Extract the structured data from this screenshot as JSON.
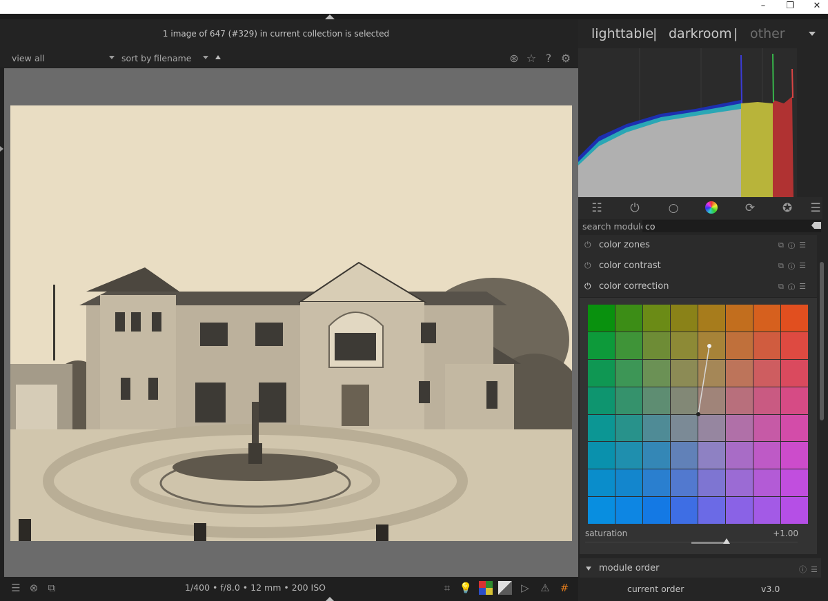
{
  "window": {
    "minimize": "–",
    "maximize": "❐",
    "close": "✕"
  },
  "status": "1 image of 647 (#329) in current collection is selected",
  "filterbar": {
    "view_label": "view",
    "view_value": "all",
    "sort_label": "sort by",
    "sort_value": "filename"
  },
  "views": {
    "lighttable": "lighttable",
    "separator": "|",
    "darkroom": "darkroom",
    "other": "other"
  },
  "exif": "1/400 • f/8.0 • 12 mm • 200 ISO",
  "search": {
    "label": "search module",
    "value": "co"
  },
  "modules": [
    {
      "label": "color zones"
    },
    {
      "label": "color contrast"
    },
    {
      "label": "color correction"
    }
  ],
  "saturation": {
    "label": "saturation",
    "value": "+1.00",
    "level": 1.0
  },
  "module_order": {
    "label": "module order",
    "current_label": "current order",
    "version": "v3.0"
  },
  "icons": {
    "header": [
      "grid-icon",
      "star-icon",
      "help-icon",
      "gear-icon"
    ],
    "tabs": [
      "sliders-icon",
      "power-icon",
      "circle-icon",
      "color-wheel-icon",
      "reset-icon",
      "aperture-icon",
      "menu-icon"
    ],
    "bottom": [
      "menu-icon",
      "shapes-icon",
      "display-icon",
      "focus-icon",
      "bulb-icon",
      "color-icon",
      "exposure-icon",
      "softproof-icon",
      "warning-icon",
      "guides-icon"
    ]
  },
  "colors": {
    "photo_tint": "#e8dcc2",
    "grid_colors": [
      [
        "#09910e",
        "#3c8d16",
        "#6b8b16",
        "#8a8218",
        "#a77c1c",
        "#c26e1e",
        "#d6601e",
        "#e14f1f"
      ],
      [
        "#0d9a3a",
        "#3f9438",
        "#6e8c36",
        "#8d8a36",
        "#a78338",
        "#c0703b",
        "#d05c3f",
        "#de4a41"
      ],
      [
        "#0f9753",
        "#3d9656",
        "#6b9155",
        "#8c8b55",
        "#a58757",
        "#bd745a",
        "#ce5d60",
        "#da4a5e"
      ],
      [
        "#0e956f",
        "#35926c",
        "#5e8d72",
        "#828876",
        "#a08479",
        "#b86f7c",
        "#c95a82",
        "#d64b85"
      ],
      [
        "#0c9694",
        "#28928b",
        "#4f8b96",
        "#7b8a96",
        "#9686a0",
        "#b070a8",
        "#c65aa6",
        "#d34ca9"
      ],
      [
        "#0a91ad",
        "#1f8fae",
        "#3487b6",
        "#6181b8",
        "#8e81c3",
        "#a86cc6",
        "#be5ac6",
        "#cc4ccb"
      ],
      [
        "#0a8dcb",
        "#1386cd",
        "#2a7fcf",
        "#5279cf",
        "#7e75d2",
        "#9b6bd4",
        "#b35bd6",
        "#c14ede"
      ],
      [
        "#088ee0",
        "#0d86e3",
        "#1479e4",
        "#3e6ee4",
        "#6b6ae6",
        "#8a62e6",
        "#a35ae6",
        "#b54fe6"
      ]
    ]
  }
}
